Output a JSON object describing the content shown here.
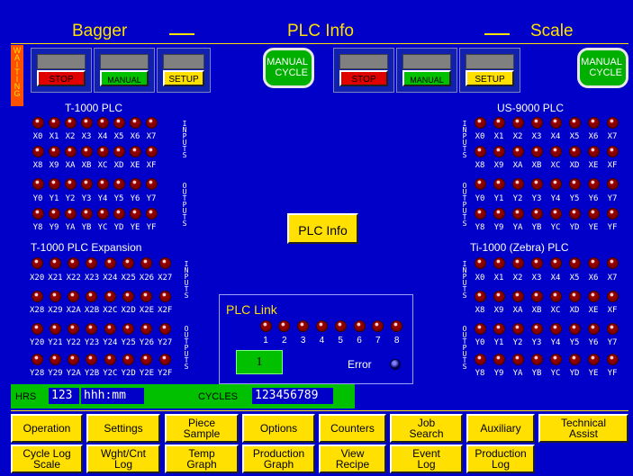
{
  "header": {
    "left": "Bagger",
    "center": "PLC Info",
    "right": "Scale"
  },
  "status_label": "WAITING",
  "bagger_buttons": {
    "stop": "STOP",
    "manual": "MANUAL",
    "setup": "SETUP"
  },
  "scale_buttons": {
    "stop": "STOP",
    "manual": "MANUAL",
    "setup": "SETUP"
  },
  "manual_cycle": {
    "line1": "MANUAL",
    "line2": "CYCLE"
  },
  "groups": {
    "t1000": {
      "title": "T-1000 PLC",
      "inputs_row1": [
        "X0",
        "X1",
        "X2",
        "X3",
        "X4",
        "X5",
        "X6",
        "X7"
      ],
      "inputs_row2": [
        "X8",
        "X9",
        "XA",
        "XB",
        "XC",
        "XD",
        "XE",
        "XF"
      ],
      "outputs_row1": [
        "Y0",
        "Y1",
        "Y2",
        "Y3",
        "Y4",
        "Y5",
        "Y6",
        "Y7"
      ],
      "outputs_row2": [
        "Y8",
        "Y9",
        "YA",
        "YB",
        "YC",
        "YD",
        "YE",
        "YF"
      ]
    },
    "t1000_exp": {
      "title": "T-1000 PLC Expansion",
      "inputs_row1": [
        "X20",
        "X21",
        "X22",
        "X23",
        "X24",
        "X25",
        "X26",
        "X27"
      ],
      "inputs_row2": [
        "X28",
        "X29",
        "X2A",
        "X2B",
        "X2C",
        "X2D",
        "X2E",
        "X2F"
      ],
      "outputs_row1": [
        "Y20",
        "Y21",
        "Y22",
        "Y23",
        "Y24",
        "Y25",
        "Y26",
        "Y27"
      ],
      "outputs_row2": [
        "Y28",
        "Y29",
        "Y2A",
        "Y2B",
        "Y2C",
        "Y2D",
        "Y2E",
        "Y2F"
      ]
    },
    "us9000": {
      "title": "US-9000 PLC",
      "inputs_row1": [
        "X0",
        "X1",
        "X2",
        "X3",
        "X4",
        "X5",
        "X6",
        "X7"
      ],
      "inputs_row2": [
        "X8",
        "X9",
        "XA",
        "XB",
        "XC",
        "XD",
        "XE",
        "XF"
      ],
      "outputs_row1": [
        "Y0",
        "Y1",
        "Y2",
        "Y3",
        "Y4",
        "Y5",
        "Y6",
        "Y7"
      ],
      "outputs_row2": [
        "Y8",
        "Y9",
        "YA",
        "YB",
        "YC",
        "YD",
        "YE",
        "YF"
      ]
    },
    "ti1000": {
      "title": "Ti-1000 (Zebra) PLC",
      "inputs_row1": [
        "X0",
        "X1",
        "X2",
        "X3",
        "X4",
        "X5",
        "X6",
        "X7"
      ],
      "inputs_row2": [
        "X8",
        "X9",
        "XA",
        "XB",
        "XC",
        "XD",
        "XE",
        "XF"
      ],
      "outputs_row1": [
        "Y0",
        "Y1",
        "Y2",
        "Y3",
        "Y4",
        "Y5",
        "Y6",
        "Y7"
      ],
      "outputs_row2": [
        "Y8",
        "Y9",
        "YA",
        "YB",
        "YC",
        "YD",
        "YE",
        "YF"
      ]
    }
  },
  "vertical_labels": {
    "inputs": "INPUTS",
    "outputs": "OUTPUTS"
  },
  "plc_info_button": "PLC Info",
  "plc_link": {
    "title": "PLC Link",
    "numbers": [
      "1",
      "2",
      "3",
      "4",
      "5",
      "6",
      "7",
      "8"
    ],
    "value": "1",
    "error_label": "Error"
  },
  "status_bar": {
    "hrs_label": "HRS",
    "hrs_value": "123",
    "time_value": "hhh:mm",
    "cycles_label": "CYCLES",
    "cycles_value": "123456789"
  },
  "nav": {
    "row1": [
      {
        "lines": [
          "Operation"
        ]
      },
      {
        "lines": [
          "Settings"
        ]
      },
      {
        "lines": [
          "Piece",
          "Sample"
        ]
      },
      {
        "lines": [
          "Options"
        ]
      },
      {
        "lines": [
          "Counters"
        ]
      },
      {
        "lines": [
          "Job",
          "Search"
        ]
      },
      {
        "lines": [
          "Auxiliary"
        ]
      },
      {
        "lines": [
          "Technical",
          "Assist"
        ]
      }
    ],
    "row2": [
      {
        "lines": [
          "Cycle Log",
          "Scale"
        ]
      },
      {
        "lines": [
          "Wght/Cnt",
          "Log"
        ]
      },
      {
        "lines": [
          "Temp",
          "Graph"
        ]
      },
      {
        "lines": [
          "Production",
          "Graph"
        ]
      },
      {
        "lines": [
          "View",
          "Recipe"
        ]
      },
      {
        "lines": [
          "Event",
          "Log"
        ]
      },
      {
        "lines": [
          "Production",
          "Log"
        ]
      }
    ]
  },
  "colors": {
    "background": "#0000c8",
    "accent": "#ffe000",
    "led_on": "#9a0000",
    "status_bar": "#00c000"
  }
}
